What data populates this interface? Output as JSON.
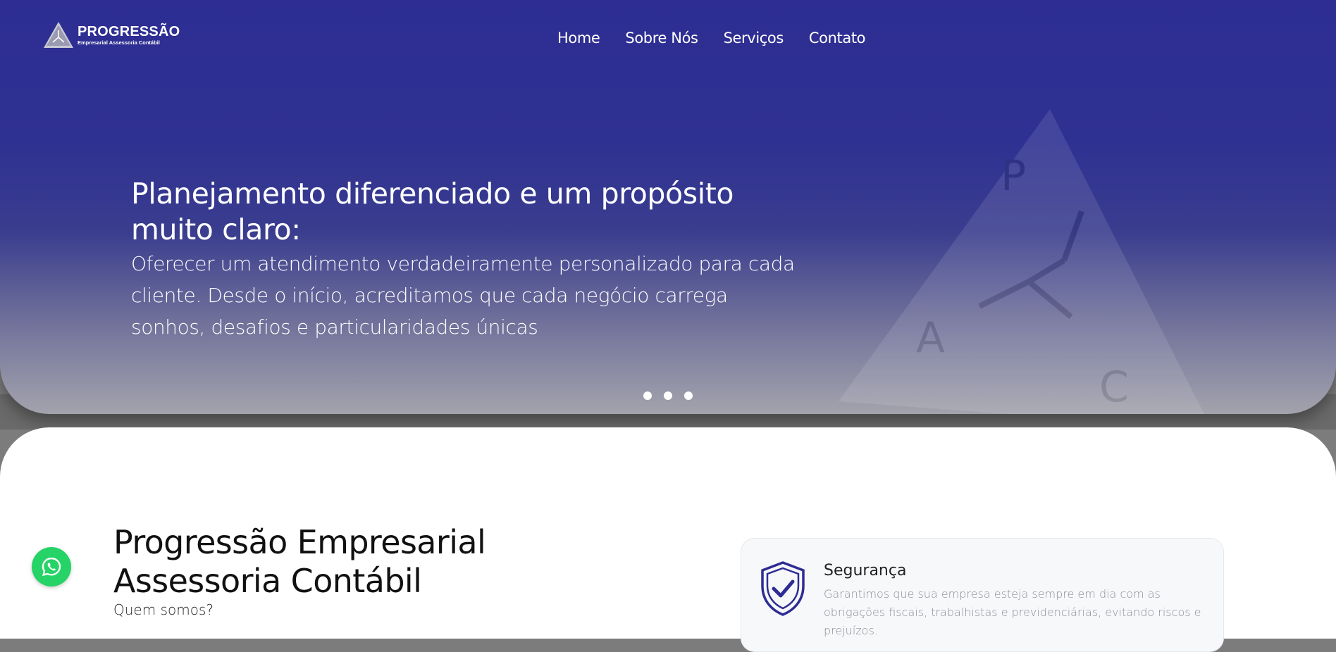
{
  "logo": {
    "title": "PROGRESSÃO",
    "subtitle": "Empresarial Assessoria Contábil"
  },
  "nav": {
    "items": [
      "Home",
      "Sobre Nós",
      "Serviços",
      "Contato"
    ]
  },
  "hero": {
    "title": "Planejamento diferenciado e um propósito muito claro:",
    "description": "Oferecer um atendimento verdadeiramente personalizado para cada cliente. Desde o início, acreditamos que cada negócio carrega sonhos, desafios e particularidades únicas",
    "slide_count": 3
  },
  "about": {
    "title": "Progressão Empresarial Assessoria Contábil",
    "subtitle": "Quem somos?"
  },
  "feature_card": {
    "icon": "shield-check-icon",
    "title": "Segurança",
    "text": "Garantimos que sua empresa esteja sempre em dia com as obrigações fiscais, trabalhistas e previdenciárias, evitando riscos e prejuízos."
  },
  "whatsapp": {
    "icon": "whatsapp-icon"
  },
  "colors": {
    "hero_top": "#2d2d93",
    "hero_bottom": "#a3a3ad",
    "accent": "#2d2d93",
    "whatsapp": "#25d366"
  }
}
